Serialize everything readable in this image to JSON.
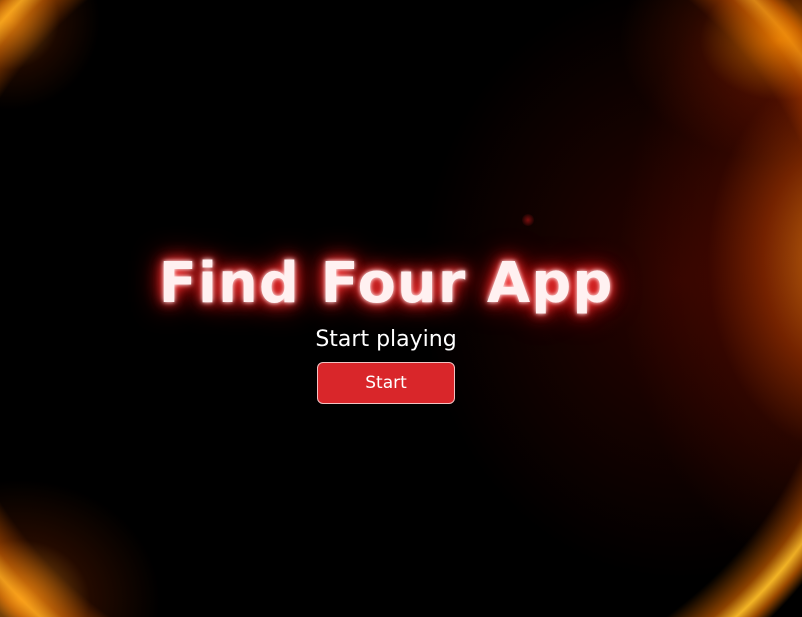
{
  "app": {
    "title": "Find Four App",
    "subtitle": "Start playing",
    "start_label": "Start"
  },
  "theme": {
    "background": "#000000",
    "title_glow": "#ff2020",
    "button_color": "#d9262a",
    "ring_color": "#ffb020"
  }
}
